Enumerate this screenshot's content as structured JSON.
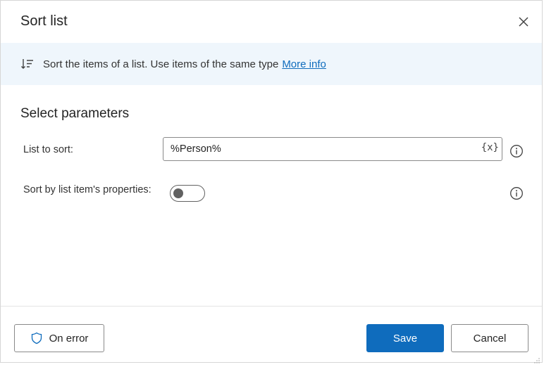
{
  "dialog": {
    "title": "Sort list",
    "close_icon": "close-icon"
  },
  "banner": {
    "icon": "sort-icon",
    "description": "Sort the items of a list. Use items of the same type",
    "more_info": "More info"
  },
  "parameters": {
    "section_title": "Select parameters",
    "list_to_sort": {
      "label": "List to sort:",
      "value": "%Person%",
      "variable_button": "{x}"
    },
    "sort_by_props": {
      "label": "Sort by list item's properties:",
      "enabled": false
    }
  },
  "footer": {
    "on_error": "On error",
    "save": "Save",
    "cancel": "Cancel"
  },
  "colors": {
    "accent": "#0f6cbd",
    "banner_bg": "#eff6fc"
  }
}
